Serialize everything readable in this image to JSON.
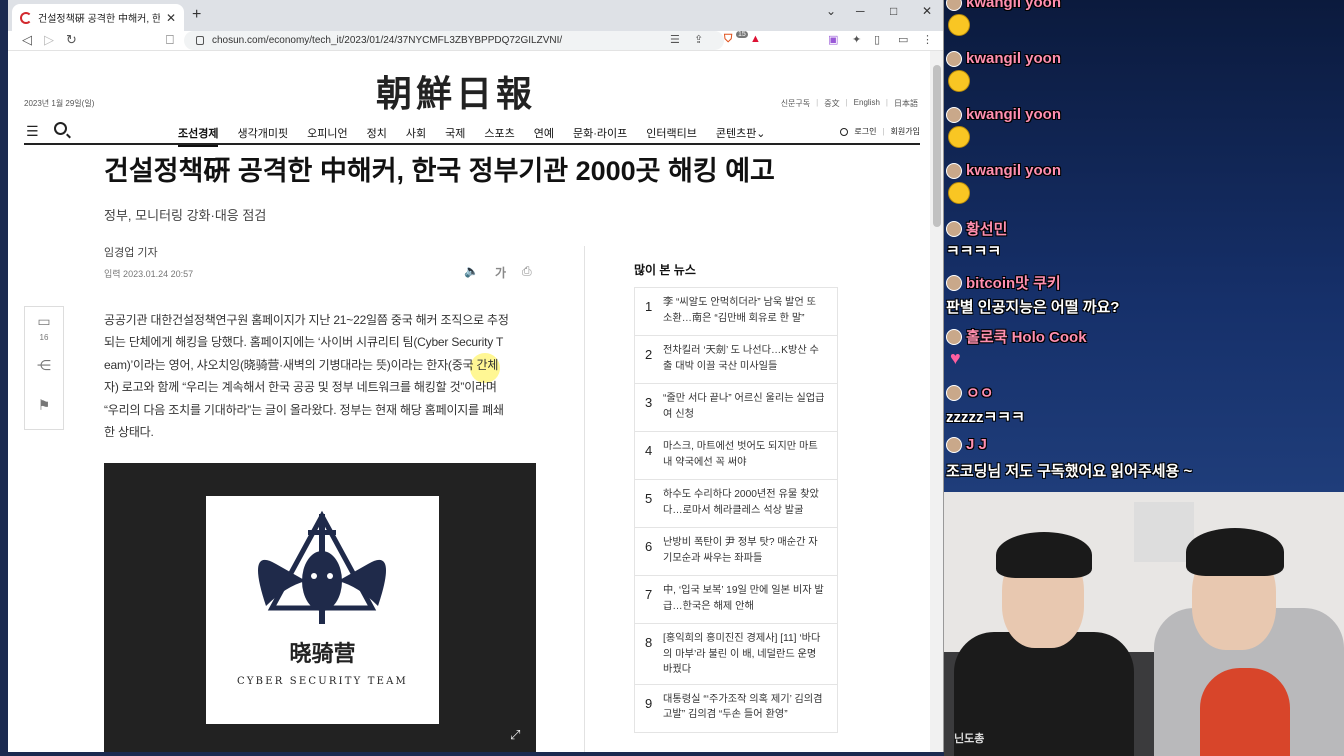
{
  "browser": {
    "tab_title": "건설정책硏 공격한 中해커, 한국 정부기관",
    "url": "chosun.com/economy/tech_it/2023/01/24/37NYCMFL3ZBYBPPDQ72GILZVNI/",
    "window_controls": {
      "minimize": "─",
      "maximize": "□",
      "close": "✕",
      "tab_close": "✕",
      "new_tab": "+"
    },
    "extension_badge": "15"
  },
  "site": {
    "date": "2023년 1월 29일(일)",
    "logo": "朝鮮日報",
    "top_links": [
      "신문구독",
      "중文",
      "English",
      "日本語"
    ],
    "nav": [
      "조선경제",
      "생각개미핏",
      "오피니언",
      "정치",
      "사회",
      "국제",
      "스포츠",
      "연예",
      "문화·라이프",
      "인터랙티브",
      "콘텐츠판⌄"
    ],
    "login": "로그인",
    "signup": "회원가입"
  },
  "article": {
    "headline": "건설정책硏 공격한 中해커, 한국 정부기관 2000곳 해킹 예고",
    "subhead": "정부, 모니터링 강화·대응 점검",
    "byline": "임경업 기자",
    "published": "입력 2023.01.24 20:57",
    "tools": {
      "audio": "🔈",
      "font": "가",
      "print": "⎙"
    },
    "comment_count": "16",
    "body_lines": [
      "공공기관 대한건설정책연구원 홈페이지가 지난 21~22일쯤 중국 해커 조직으로 추정",
      "되는 단체에게 해킹을 당했다. 홈페이지에는 ‘사이버 시큐리티 팀(Cyber Security T",
      "eam)’이라는 영어, 샤오치잉(晓骑营·새벽의 기병대라는 뜻)이라는 한자(중국 간체",
      "자) 로고와 함께 “우리는 계속해서 한국 공공 및 정부 네트워크를 해킹할 것”이라며",
      "“우리의 다음 조치를 기대하라”는 글이 올라왔다. 정부는 현재 해당 홈페이지를 폐쇄",
      "한 상태다."
    ],
    "figure": {
      "hanzi": "晓骑营",
      "team": "CYBER SECURITY TEAM",
      "expand_icon": "⤢"
    }
  },
  "popular": {
    "title": "많이 본 뉴스",
    "items": [
      {
        "rank": "1",
        "text": "李 “씨알도 안먹히더라” 남욱 발언 또 소환…南은 “김만배 회유로 한 말”"
      },
      {
        "rank": "2",
        "text": "전차킬러 ‘天劍’ 도 나선다…K방산 수출 대박 이끌 국산 미사일들"
      },
      {
        "rank": "3",
        "text": "“줄만 서다 끝나” 어르신 울리는 실업급여 신청"
      },
      {
        "rank": "4",
        "text": "마스크, 마트에선 벗어도 되지만 마트 내 약국에선 꼭 써야"
      },
      {
        "rank": "5",
        "text": "하수도 수리하다 2000년전 유물 찾았다…로마서 헤라클레스 석상 발굴"
      },
      {
        "rank": "6",
        "text": "난방비 폭탄이 尹 정부 탓? 매순간 자기모순과 싸우는 좌파들"
      },
      {
        "rank": "7",
        "text": "中, ‘입국 보복’ 19일 만에 일본 비자 발급…한국은 해제 안해"
      },
      {
        "rank": "8",
        "text": "[홍익희의 홍미진진 경제사] [11] ‘바다의 마부’라 불린 이 배, 네덜란드 운명 바꿨다"
      },
      {
        "rank": "9",
        "text": "대통령실 “‘주가조작 의혹 제기’ 김의겸 고발” 김의겸 “두손 들어 환영”"
      }
    ]
  },
  "stream": {
    "chat": [
      {
        "nick": "kwangil yoon",
        "msg": ""
      },
      {
        "nick": "kwangil yoon",
        "msg": ""
      },
      {
        "nick": "kwangil yoon",
        "msg": ""
      },
      {
        "nick": "kwangil yoon",
        "msg": ""
      },
      {
        "nick": "황선민",
        "msg": "ㅋㅋㅋㅋ"
      },
      {
        "nick": "bitcoin맛 쿠키",
        "msg": "판별 인공지능은 어떨 까요?"
      },
      {
        "nick": "홀로쿡 Holo Cook",
        "msg": ""
      },
      {
        "nick": "ㅇㅇ",
        "msg": "zzzzzㅋㅋㅋ"
      },
      {
        "nick": "J J",
        "msg": "조코딩님 저도 구독했어요 읽어주세용 ~"
      }
    ],
    "cam_logo": "닌도총"
  },
  "colors": {
    "chat_nick": "#ff8fb0",
    "logo": "#222222",
    "accent": "#d2282d"
  }
}
